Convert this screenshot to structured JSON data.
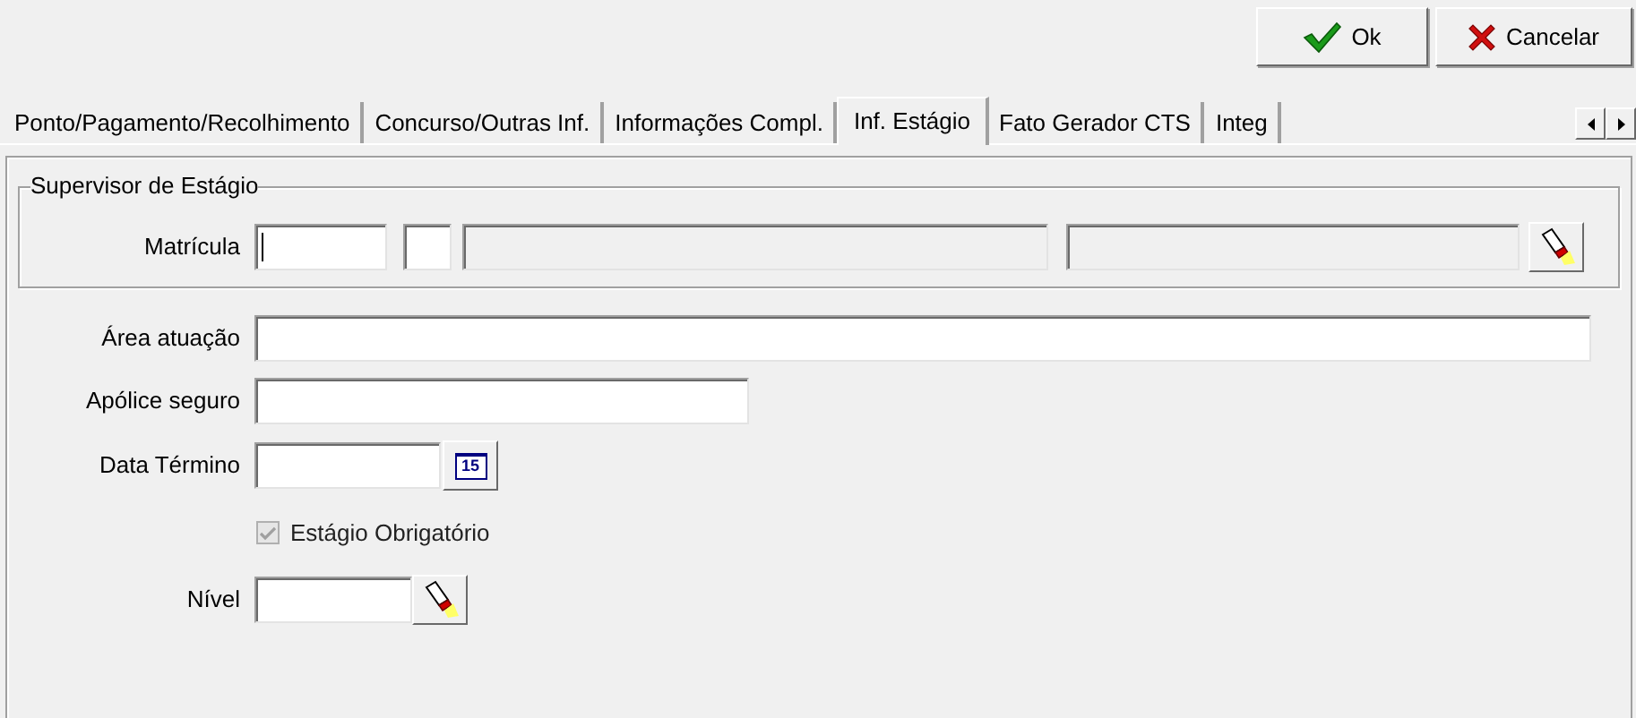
{
  "buttons": [
    {
      "kind": "ok",
      "label": "Ok"
    },
    {
      "kind": "cancel",
      "label": "Cancelar"
    }
  ],
  "tabs": [
    {
      "label": "Ponto/Pagamento/Recolhimento",
      "selected": false
    },
    {
      "label": "Concurso/Outras Inf.",
      "selected": false
    },
    {
      "label": "Informações Compl.",
      "selected": false
    },
    {
      "label": "Inf. Estágio",
      "selected": true
    },
    {
      "label": "Fato Gerador CTS",
      "selected": false
    },
    {
      "label": "Integ",
      "selected": false
    }
  ],
  "supervisor": {
    "title": "Supervisor de Estágio",
    "label": "Matrícula",
    "fields": [
      {
        "disabled": false
      },
      {
        "disabled": false
      },
      {
        "disabled": true
      },
      {
        "disabled": true
      }
    ]
  },
  "area": {
    "label": "Área atuação"
  },
  "apolice": {
    "label": "Apólice seguro"
  },
  "data_termino": {
    "label": "Data Término",
    "calendar": "15"
  },
  "obrigatorio": {
    "label": "Estágio Obrigatório",
    "checked": true,
    "disabled": true
  },
  "nivel": {
    "label": "Nível"
  }
}
